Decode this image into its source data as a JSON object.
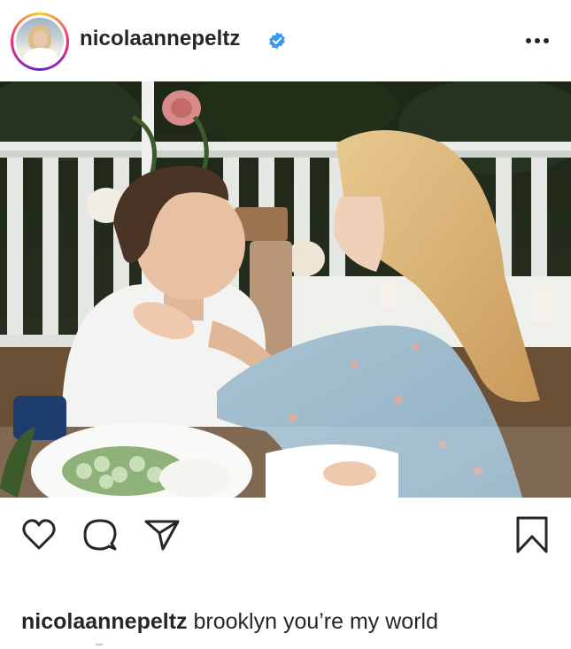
{
  "post": {
    "username": "nicolaannepeltz",
    "verified": true,
    "caption_user": "nicolaannepeltz",
    "caption_text": "brooklyn you’re my world"
  },
  "icons": {
    "avatar": "profile-avatar",
    "verified": "verified-badge-icon",
    "more": "more-options-icon",
    "like": "heart-icon",
    "comment": "comment-bubble-icon",
    "share": "paper-plane-icon",
    "save": "bookmark-icon"
  },
  "colors": {
    "text": "#262626",
    "verified_blue": "#3897f0",
    "background": "#ffffff"
  }
}
